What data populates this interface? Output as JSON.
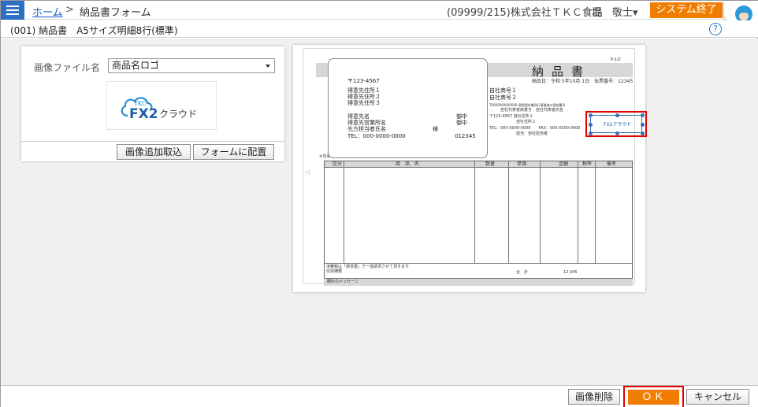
{
  "header": {
    "home_link": "ホーム",
    "separator": ">",
    "current_page": "納品書フォーム",
    "company": "(09999/215)株式会社ＴＫＣ食品",
    "user": "堤　敬士▾",
    "system_exit": "システム終了"
  },
  "subheader": {
    "form_name": "(001) 納品書　A5サイズ明細8行(標準)",
    "help_icon": "?"
  },
  "left_panel": {
    "image_file_label": "画像ファイル名",
    "image_file_value": "商品名ロゴ",
    "logo_tkc": "TKC",
    "logo_fx2": "FX2",
    "logo_cloud": "クラウド",
    "add_image_button": "画像追加取込",
    "place_on_form_button": "フォームに配置"
  },
  "preview": {
    "page_number": "P-1/2",
    "doc_title": "納品書",
    "doc_date": "納品日：令和 5年10月 1日　伝票番号：12345",
    "address": {
      "postal": "〒123-4567",
      "addr1": "得意先住所１",
      "addr2": "得意先住所２",
      "addr3": "得意先住所３",
      "cust_name": "得意先名",
      "cust_name_honor": "御中",
      "cust_dept": "得意先営業所名",
      "cust_dept_honor": "御中",
      "contact": "先方担当者氏名",
      "contact_honor": "様",
      "tel": "TEL：000-0000-0000",
      "cust_code": "012345"
    },
    "company": {
      "name1": "自社商号１",
      "name2": "自社商号２",
      "reg_line": "T0000000000000 適格請求書発行事業者の登録番号",
      "rep_line": "自社代表者肩書き　自社代表者氏名",
      "addr_line": "〒123-4567 自社住所１",
      "addr2": "自社住所２",
      "tel_fax": "TEL：000-0000-0000　　FAX：000-0000-0000",
      "staff": "担当：自社担当者"
    },
    "invoice_note": "※当事項はインボイスに該当しますので、適切に保管してください。",
    "table_headers": [
      "区分",
      "商　品　名",
      "数量",
      "単価",
      "金額",
      "税率",
      "備考"
    ],
    "tax_note": "消費税は「請求書」で一括請求させて頂きます",
    "memo": "伝票摘要",
    "total_label": "合　計",
    "total_value": "12,345",
    "footer_message": "欄外のメッセージ",
    "placed_logo": "FX2クラウド",
    "nav_left": "◁"
  },
  "footer": {
    "delete_image_button": "画像削除",
    "ok_button": "ＯＫ",
    "cancel_button": "キャンセル"
  },
  "colors": {
    "accent_blue": "#2d6fc4",
    "accent_orange": "#f07d00",
    "highlight_red": "#e30000"
  }
}
